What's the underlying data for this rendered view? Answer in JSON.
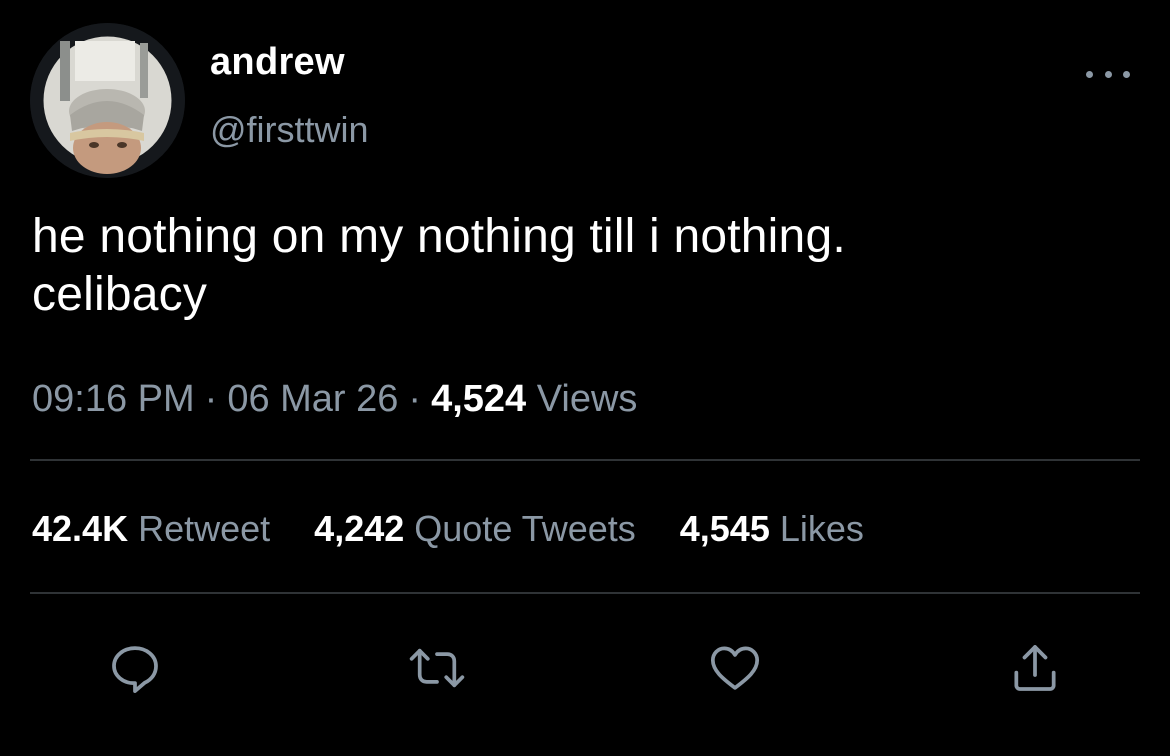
{
  "tweet": {
    "author": {
      "display_name": "andrew",
      "handle": "@firsttwin"
    },
    "text_lines": [
      "he nothing on my nothing till i nothing.",
      "celibacy"
    ],
    "time": "09:16 PM",
    "date": "06 Mar 26",
    "views_count": "4,524",
    "views_label": "Views",
    "separator": "·",
    "stats": {
      "retweets_count": "42.4K",
      "retweets_label": "Retweet",
      "quotes_count": "4,242",
      "quotes_label": "Quote Tweets",
      "likes_count": "4,545",
      "likes_label": "Likes"
    },
    "actions": [
      "reply-icon",
      "retweet-icon",
      "like-icon",
      "share-icon"
    ]
  },
  "colors": {
    "background": "#000000",
    "primary_text": "#ffffff",
    "secondary_text": "#8b98a5",
    "divider": "#2f3336"
  }
}
